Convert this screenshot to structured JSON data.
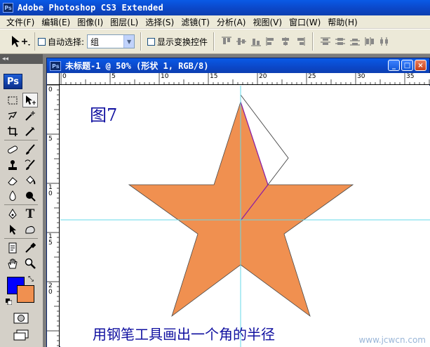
{
  "app": {
    "title": "Adobe Photoshop CS3 Extended",
    "logo_text": "Ps"
  },
  "menu": [
    "文件(F)",
    "编辑(E)",
    "图像(I)",
    "图层(L)",
    "选择(S)",
    "滤镜(T)",
    "分析(A)",
    "视图(V)",
    "窗口(W)",
    "帮助(H)"
  ],
  "options": {
    "auto_select_label": "自动选择:",
    "auto_select_value": "组",
    "show_transform_label": "显示变换控件"
  },
  "document": {
    "title": "未标题-1 @ 50% (形状 1, RGB/8)",
    "figure_label": "图7",
    "caption": "用钢笔工具画出一个角的半径",
    "watermark": "www.jcwcn.com"
  },
  "rulers": {
    "horizontal": [
      "0",
      "5",
      "10",
      "15",
      "20",
      "25",
      "30",
      "35"
    ],
    "vertical": [
      "0",
      "5",
      "1\n0",
      "1\n5",
      "2\n0"
    ]
  },
  "colors": {
    "foreground": "#0000ff",
    "background": "#f09050",
    "star_fill": "#f09050",
    "guide": "#66d9e8"
  }
}
